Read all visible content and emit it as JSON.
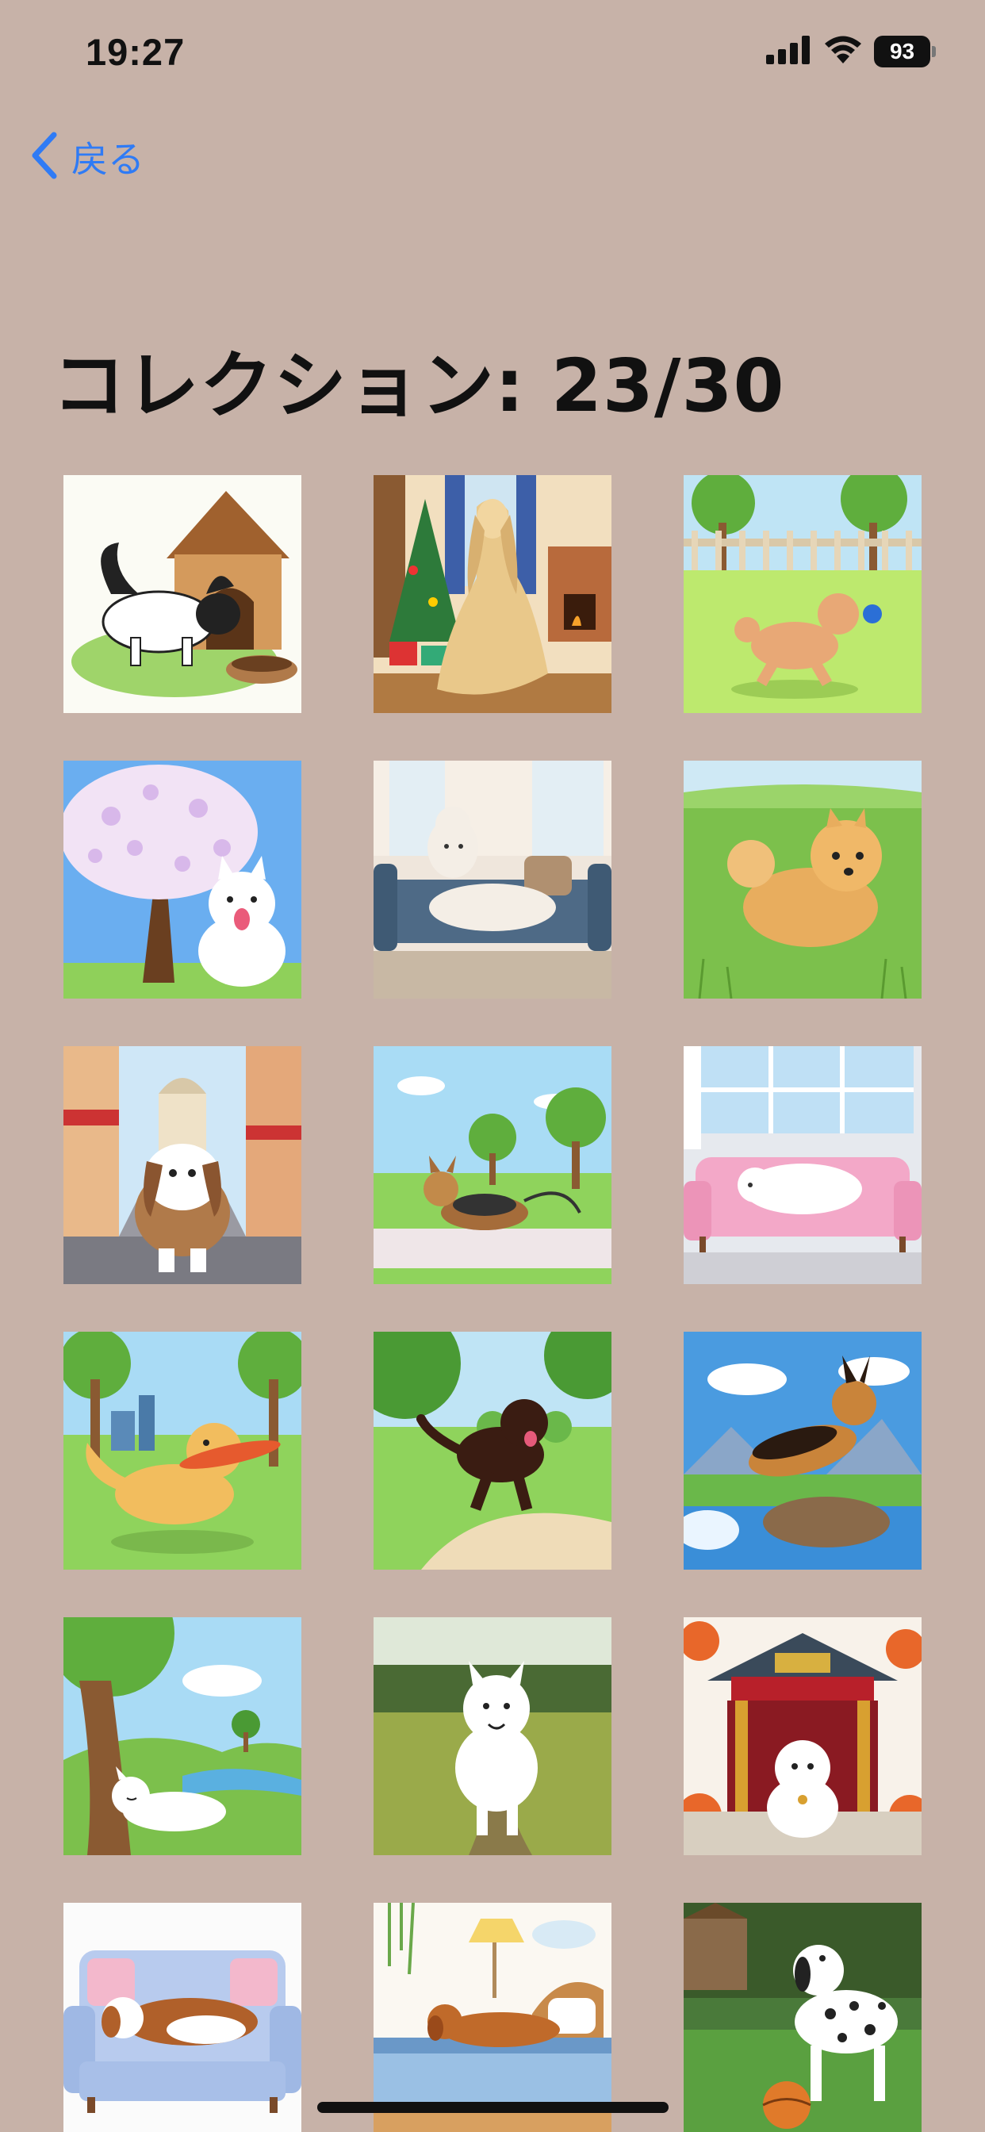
{
  "status_bar": {
    "time": "19:27",
    "battery": "93"
  },
  "nav": {
    "back_label": "戻る"
  },
  "title": "コレクション: 23/30",
  "icons": {
    "signal": "cellular-signal-icon",
    "wifi": "wifi-icon",
    "battery": "battery-icon",
    "back": "chevron-left-icon"
  },
  "colors": {
    "background": "#c7b2a8",
    "accent": "#2f7bf5"
  },
  "collection_items": [
    {
      "subject": "papillon-doghouse"
    },
    {
      "subject": "afghan-hound-christmas"
    },
    {
      "subject": "poodle-running-park"
    },
    {
      "subject": "samoyed-cherry-blossom"
    },
    {
      "subject": "poodle-on-sofa"
    },
    {
      "subject": "pomeranian-grass"
    },
    {
      "subject": "shih-tzu-street"
    },
    {
      "subject": "yorkshire-terrier-park"
    },
    {
      "subject": "white-dog-pink-sofa"
    },
    {
      "subject": "golden-retriever-frisbee"
    },
    {
      "subject": "flat-coated-retriever-path"
    },
    {
      "subject": "german-shepherd-river"
    },
    {
      "subject": "westie-lying-tree"
    },
    {
      "subject": "white-spitz-meadow"
    },
    {
      "subject": "maltese-temple-autumn"
    },
    {
      "subject": "cavalier-on-sofa"
    },
    {
      "subject": "dachshund-on-bed"
    },
    {
      "subject": "dalmatian-ball"
    }
  ]
}
